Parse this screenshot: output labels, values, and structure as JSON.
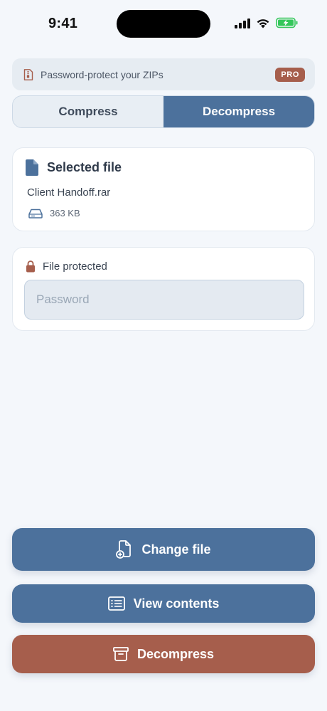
{
  "status_bar": {
    "time": "9:41"
  },
  "banner": {
    "text": "Password-protect your ZIPs",
    "badge": "PRO"
  },
  "tabs": [
    {
      "label": "Compress",
      "active": false
    },
    {
      "label": "Decompress",
      "active": true
    }
  ],
  "selected_file": {
    "title": "Selected file",
    "name": "Client Handoff.rar",
    "size": "363 KB"
  },
  "protection": {
    "label": "File protected",
    "password_placeholder": "Password",
    "password_value": ""
  },
  "actions": {
    "change_file": "Change file",
    "view_contents": "View contents",
    "decompress": "Decompress"
  },
  "colors": {
    "accent": "#4c719c",
    "pro": "#a65e4c",
    "battery": "#33c75a",
    "background": "#f4f7fb"
  },
  "icons": {
    "banner": "zip-file-icon",
    "file": "document-icon",
    "size": "drive-icon",
    "lock": "lock-icon",
    "change": "add-document-icon",
    "view": "list-icon",
    "decompress": "archive-box-icon"
  }
}
